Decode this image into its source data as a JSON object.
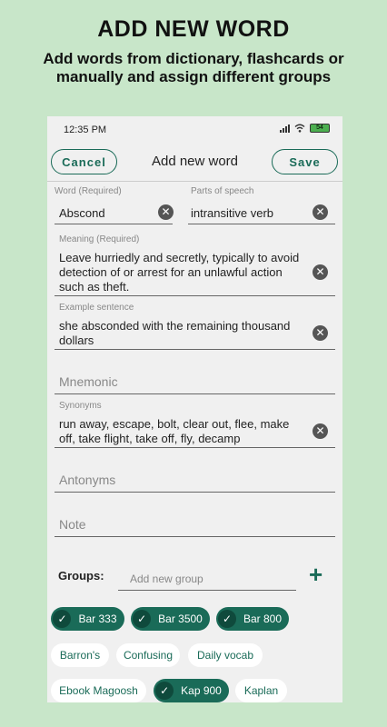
{
  "promo": {
    "title": "ADD NEW WORD",
    "subtitle": "Add words from dictionary, flashcards or manually and assign different groups"
  },
  "status_bar": {
    "time": "12:35 PM",
    "battery": "54"
  },
  "app_bar": {
    "cancel_label": "Cancel",
    "title": "Add new word",
    "save_label": "Save"
  },
  "form": {
    "word": {
      "label": "Word (Required)",
      "value": "Abscond"
    },
    "parts_of_speech": {
      "label": "Parts of speech",
      "value": "intransitive verb"
    },
    "meaning": {
      "label": "Meaning (Required)",
      "value": "Leave hurriedly and secretly, typically to avoid detection of or arrest for an unlawful action such as theft."
    },
    "example": {
      "label": "Example sentence",
      "value": "she absconded with the remaining thousand dollars"
    },
    "mnemonic": {
      "placeholder": "Mnemonic"
    },
    "synonyms": {
      "label": "Synonyms",
      "value": "run away, escape, bolt, clear out, flee, make off, take flight, take off, fly, decamp"
    },
    "antonyms": {
      "placeholder": "Antonyms"
    },
    "note": {
      "placeholder": "Note"
    }
  },
  "groups": {
    "label": "Groups:",
    "input_placeholder": "Add new group",
    "chips": [
      {
        "label": "Bar 333",
        "selected": true
      },
      {
        "label": "Bar 3500",
        "selected": true
      },
      {
        "label": "Bar 800",
        "selected": true
      },
      {
        "label": "Barron's",
        "selected": false
      },
      {
        "label": "Confusing",
        "selected": false
      },
      {
        "label": "Daily vocab",
        "selected": false
      },
      {
        "label": "Ebook Magoosh",
        "selected": false
      },
      {
        "label": "Kap 900",
        "selected": true
      },
      {
        "label": "Kaplan",
        "selected": false
      }
    ]
  },
  "icons": {
    "clear": "close-circle-icon",
    "add": "plus-icon",
    "check": "check-icon"
  },
  "colors": {
    "background": "#c8e6c9",
    "accent": "#1a6b58",
    "screen": "#f0f0f0"
  }
}
